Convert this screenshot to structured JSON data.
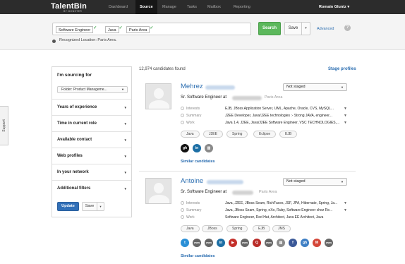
{
  "app": {
    "logo": "TalentBin",
    "logo_sub": "BY MONSTER"
  },
  "nav": {
    "items": [
      {
        "label": "Dashboard"
      },
      {
        "label": "Source"
      },
      {
        "label": "Manage"
      },
      {
        "label": "Tasks"
      },
      {
        "label": "Mailbox"
      },
      {
        "label": "Reporting"
      }
    ],
    "user": "Romain Gluntz ▾"
  },
  "search": {
    "tags": [
      "Software Engineer",
      "Java",
      "Paris Area"
    ],
    "search_label": "Search",
    "save_label": "Save",
    "dropdown_glyph": "▾",
    "advanced_label": "Advanced",
    "help_glyph": "?",
    "recognized_location": "Recognized Location: Paris Area."
  },
  "support": {
    "label": "Support"
  },
  "sidebar": {
    "title": "I'm sourcing for",
    "folder_select": "Folder: Product Manageme...",
    "sections": [
      "Years of experience",
      "Time in current role",
      "Available contact",
      "Web profiles",
      "In your network",
      "Additional filters"
    ],
    "update_label": "Update",
    "save_label": "Save"
  },
  "results": {
    "count_text": "12,974 candidates found",
    "stage_profiles_label": "Stage profiles",
    "candidates": [
      {
        "first_name": "Mehrez",
        "role_prefix": "Sr. Software Engineer at",
        "location": "Paris Area",
        "stage": "Not staged",
        "fields": [
          {
            "label": "Interests",
            "value": "EJB, JBoss Application Server, UML, Apache, Oracle, CVS, MySQL..."
          },
          {
            "label": "Summary",
            "value": "J2EE Developer, Java/J2EE technologies :- Strong JAVA, engineer..."
          },
          {
            "label": "Work",
            "value": "Java 1.4, J2EE, Java/J2EE Software Engineer, VSC TECHNOLOGIES,..."
          }
        ],
        "chips": [
          "Java",
          "J2EE",
          "Spring",
          "Eclipse",
          "EJB"
        ],
        "social_icons": [
          {
            "name": "github-icon",
            "text": "gh",
            "color": "#111111"
          },
          {
            "name": "linkedin-icon",
            "text": "in",
            "color": "#1d6fa5"
          },
          {
            "name": "stats-icon",
            "text": "▥",
            "color": "#8a8a8a"
          }
        ],
        "similar_label": "Similar candidates"
      },
      {
        "first_name": "Antoine",
        "role_prefix": "Sr. Software Engineer at",
        "location": "Paris Area",
        "stage": "Not staged",
        "fields": [
          {
            "label": "Interests",
            "value": "Java, J2EE, JBoss Seam, RichFaces, JSF, JPA, Hibernate, Spring, Ja..."
          },
          {
            "label": "Summary",
            "value": "Java, JBoss Seam, Spring, eXo, Ruby, Software Engineer chez Re..."
          },
          {
            "label": "Work",
            "value": "Software Engineer, Red Hat, Architect, Java EE Architect, Java"
          }
        ],
        "chips": [
          "Java",
          "JBoss",
          "Spring",
          "EJB",
          "JMS"
        ],
        "social_icons": [
          {
            "name": "twitter-icon",
            "text": "t",
            "color": "#2a8fd6"
          },
          {
            "name": "www-icon",
            "text": "www",
            "color": "#666666"
          },
          {
            "name": "www-icon",
            "text": "www",
            "color": "#666666"
          },
          {
            "name": "linkedin-icon",
            "text": "in",
            "color": "#1d6fa5"
          },
          {
            "name": "youtube-icon",
            "text": "▶",
            "color": "#c4302b"
          },
          {
            "name": "www-icon",
            "text": "www",
            "color": "#666666"
          },
          {
            "name": "quora-icon",
            "text": "Q",
            "color": "#b92b27"
          },
          {
            "name": "www-icon",
            "text": "www",
            "color": "#666666"
          },
          {
            "name": "stats-icon",
            "text": "▥",
            "color": "#8a8a8a"
          },
          {
            "name": "facebook-icon",
            "text": "f",
            "color": "#3b5998"
          },
          {
            "name": "github-icon",
            "text": "gh",
            "color": "#3d7ec4"
          },
          {
            "name": "gmail-icon",
            "text": "M",
            "color": "#d44638"
          },
          {
            "name": "www-icon",
            "text": "www",
            "color": "#666666"
          }
        ],
        "similar_label": "Similar candidates"
      }
    ]
  }
}
